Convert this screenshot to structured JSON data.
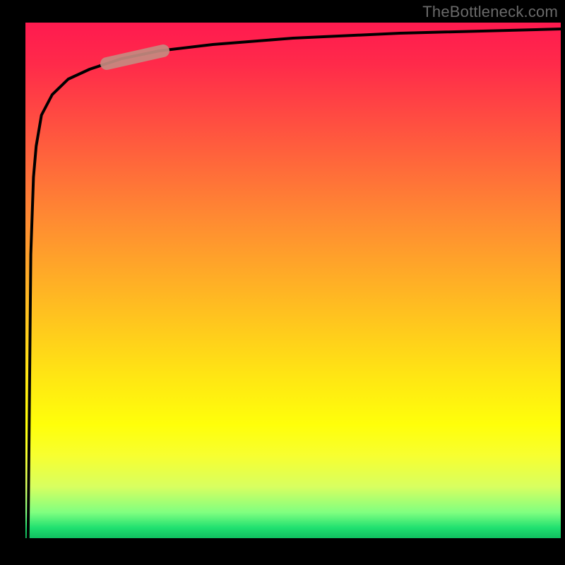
{
  "attribution": "TheBottleneck.com",
  "colors": {
    "background": "#000000",
    "curve": "#000000",
    "marker": "#c58a80",
    "gradient_top": "#ff1a4f",
    "gradient_mid": "#ffd000",
    "gradient_bottom": "#10c060",
    "text": "#6a6a6a"
  },
  "chart_data": {
    "type": "line",
    "title": "",
    "xlabel": "",
    "ylabel": "",
    "xlim": [
      0,
      100
    ],
    "ylim": [
      0,
      100
    ],
    "grid": false,
    "legend": false,
    "series": [
      {
        "name": "curve",
        "x": [
          0.5,
          1,
          1.5,
          2,
          3,
          5,
          8,
          12,
          18,
          25,
          35,
          50,
          70,
          100
        ],
        "y": [
          0,
          55,
          70,
          76,
          82,
          86,
          89,
          91,
          93,
          94.5,
          95.8,
          97,
          98,
          98.8
        ]
      }
    ],
    "marker": {
      "note": "highlighted segment on the curve",
      "x_range": [
        16,
        25
      ],
      "approx_y": 93.5,
      "color": "#c58a80"
    }
  }
}
